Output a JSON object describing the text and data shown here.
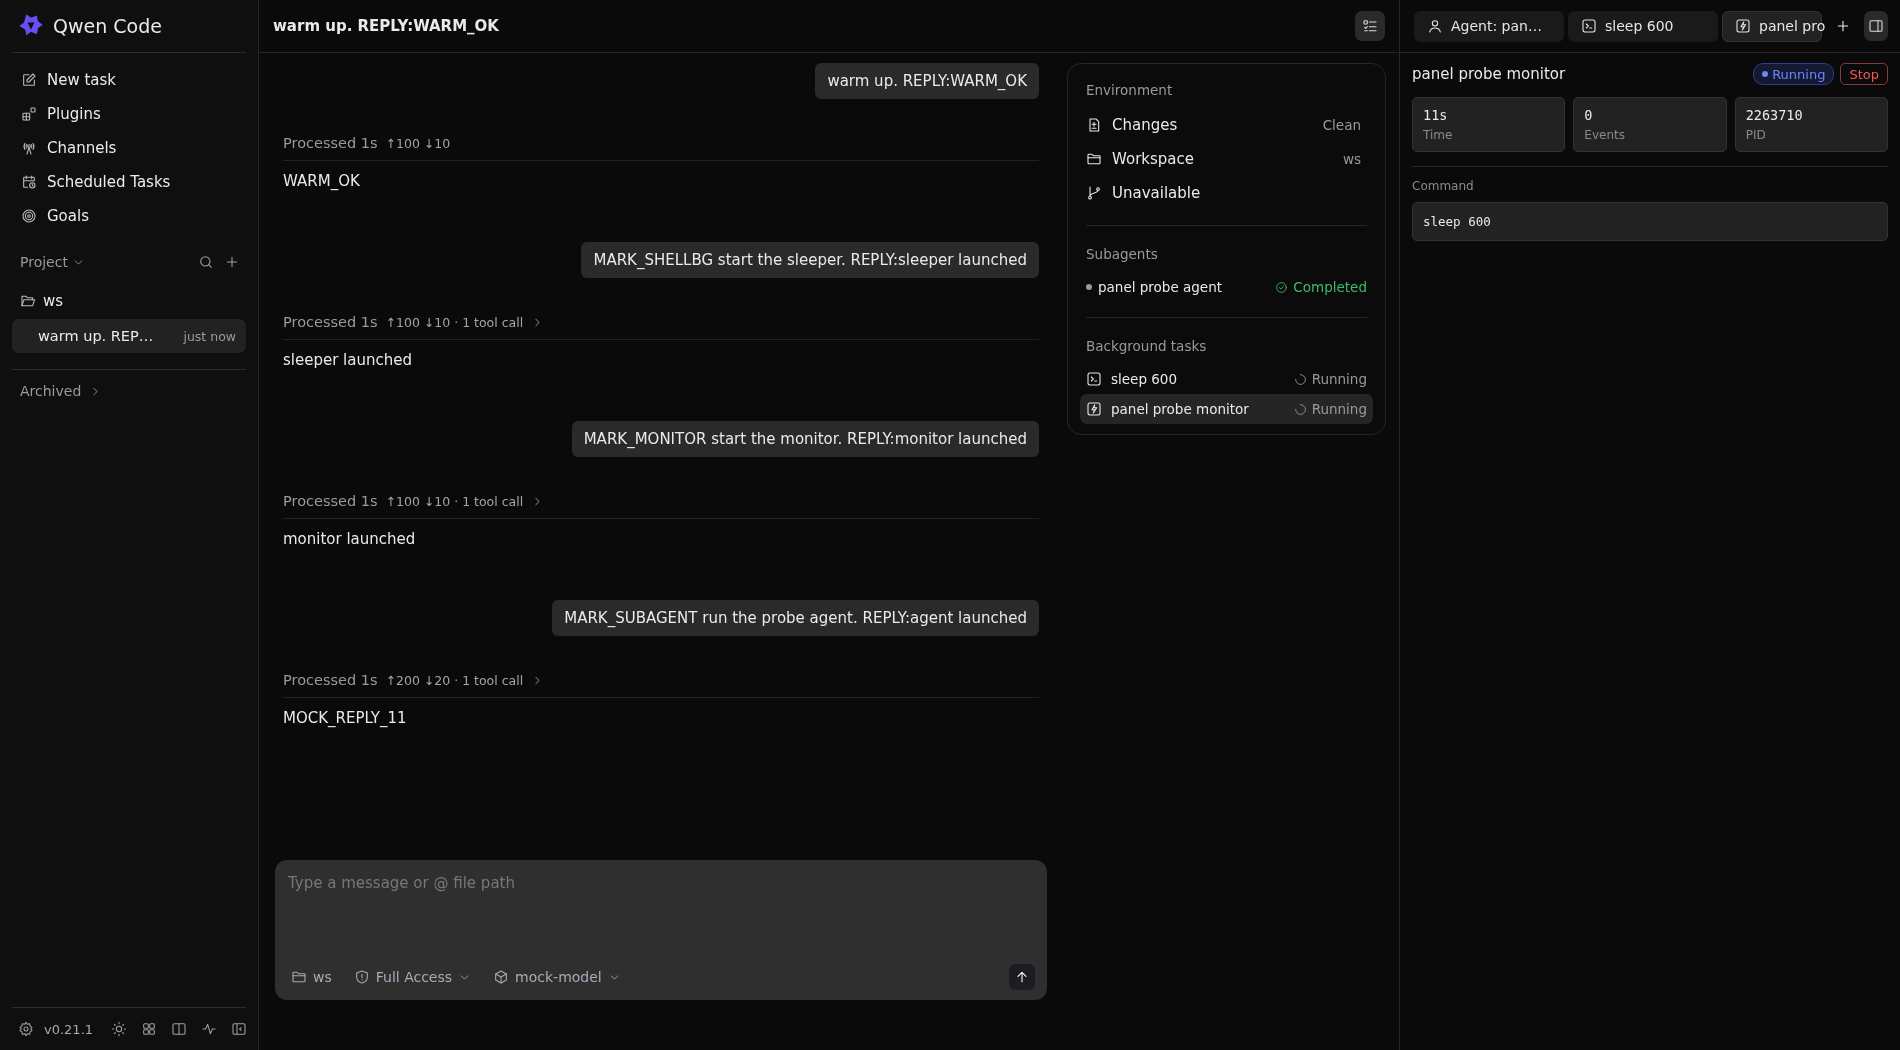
{
  "sidebar": {
    "brand": "Qwen Code",
    "nav": [
      {
        "label": "New task"
      },
      {
        "label": "Plugins"
      },
      {
        "label": "Channels"
      },
      {
        "label": "Scheduled Tasks"
      },
      {
        "label": "Goals"
      }
    ],
    "project_label": "Project",
    "projects": [
      {
        "name": "ws",
        "tasks": [
          {
            "title": "warm up. REP…",
            "time": "just now",
            "selected": true
          }
        ]
      }
    ],
    "archived": "Archived",
    "version": "v0.21.1"
  },
  "chat": {
    "title": "warm up. REPLY:WARM_OK",
    "messages": [
      {
        "kind": "user",
        "text": "warm up. REPLY:WARM_OK"
      },
      {
        "kind": "meta",
        "label": "Processed 1s",
        "stats": "↑100 ↓10",
        "expandable": false
      },
      {
        "kind": "reply",
        "text": "WARM_OK"
      },
      {
        "kind": "user",
        "text": "MARK_SHELLBG start the sleeper. REPLY:sleeper launched"
      },
      {
        "kind": "meta",
        "label": "Processed 1s",
        "stats": "↑100 ↓10 · 1 tool call",
        "expandable": true
      },
      {
        "kind": "reply",
        "text": "sleeper launched"
      },
      {
        "kind": "user",
        "text": "MARK_MONITOR start the monitor. REPLY:monitor launched"
      },
      {
        "kind": "meta",
        "label": "Processed 1s",
        "stats": "↑100 ↓10 · 1 tool call",
        "expandable": true
      },
      {
        "kind": "reply",
        "text": "monitor launched"
      },
      {
        "kind": "user",
        "text": "MARK_SUBAGENT run the probe agent. REPLY:agent launched"
      },
      {
        "kind": "meta",
        "label": "Processed 1s",
        "stats": "↑200 ↓20 · 1 tool call",
        "expandable": true
      },
      {
        "kind": "reply",
        "text": "MOCK_REPLY_11"
      }
    ],
    "composer": {
      "placeholder": "Type a message or @ file path",
      "workspace": "ws",
      "access": "Full Access",
      "model": "mock-model"
    }
  },
  "context": {
    "environment_title": "Environment",
    "environment": [
      {
        "kind": "changes",
        "label": "Changes",
        "value": "Clean"
      },
      {
        "kind": "workspace",
        "label": "Workspace",
        "value": "ws"
      },
      {
        "kind": "branch",
        "label": "Unavailable"
      }
    ],
    "subagents_title": "Subagents",
    "subagents": [
      {
        "name": "panel probe agent",
        "status": "Completed"
      }
    ],
    "tasks_title": "Background tasks",
    "tasks": [
      {
        "kind": "shell",
        "name": "sleep 600",
        "status": "Running",
        "selected": false
      },
      {
        "kind": "monitor",
        "name": "panel probe monitor",
        "status": "Running",
        "selected": true
      }
    ]
  },
  "detail": {
    "tabs": [
      {
        "kind": "agent",
        "label": "Agent: pan…",
        "selected": false
      },
      {
        "kind": "shell",
        "label": "sleep 600",
        "selected": false
      },
      {
        "kind": "monitor",
        "label": "panel pro",
        "selected": true
      }
    ],
    "title": "panel probe monitor",
    "status": "Running",
    "stop": "Stop",
    "stats": [
      {
        "value": "11s",
        "label": "Time"
      },
      {
        "value": "0",
        "label": "Events"
      },
      {
        "value": "2263710",
        "label": "PID"
      }
    ],
    "command_label": "Command",
    "command": "sleep 600"
  }
}
